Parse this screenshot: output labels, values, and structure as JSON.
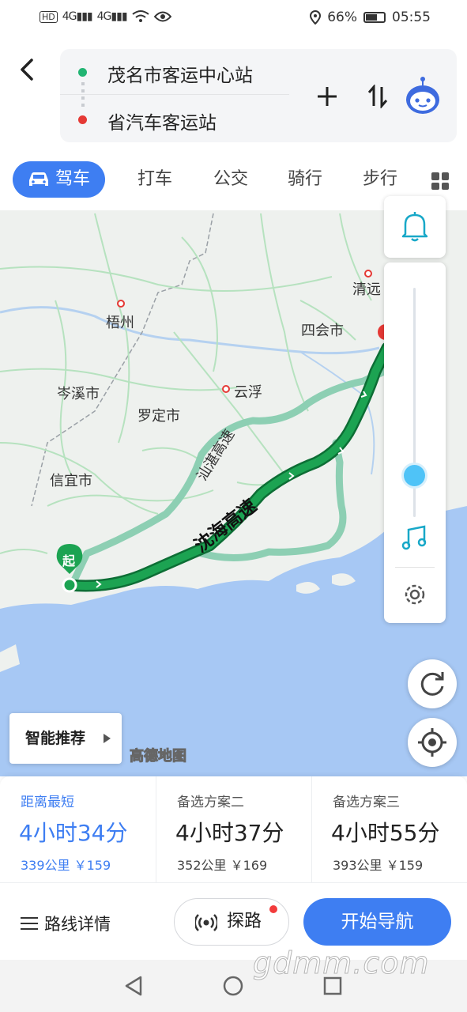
{
  "status_bar": {
    "hd": "HD",
    "sim1": "4G",
    "sim2": "4G",
    "battery": "66%",
    "time": "05:55"
  },
  "route": {
    "start": "茂名市客运中心站",
    "end": "省汽车客运站"
  },
  "tabs": [
    "驾车",
    "打车",
    "公交",
    "骑行",
    "步行"
  ],
  "map": {
    "places": [
      "清远",
      "梧州",
      "四会市",
      "岑溪市",
      "云浮",
      "罗定市",
      "信宜市"
    ],
    "roads": {
      "alt": "汕湛高速",
      "main": "沈海高速"
    },
    "start_marker": "起",
    "provider": "高德地图",
    "smart_recommend": "智能推荐",
    "zoom_level": 0.85
  },
  "plans": [
    {
      "name": "距离最短",
      "time": "4小时34分",
      "meta": "339公里 ￥159",
      "selected": true
    },
    {
      "name": "备选方案二",
      "time": "4小时37分",
      "meta": "352公里 ￥169",
      "selected": false
    },
    {
      "name": "备选方案三",
      "time": "4小时55分",
      "meta": "393公里 ￥159",
      "selected": false
    }
  ],
  "actions": {
    "details": "路线详情",
    "explore": "探路",
    "start": "开始导航"
  },
  "watermark": "gdmm.com",
  "colors": {
    "accent": "#3e7ef2",
    "route_main": "#1a9e4e",
    "route_alt": "#8dcfb3",
    "sea": "#a7c8f4",
    "start_dot": "#22b573",
    "end_dot": "#e53935"
  }
}
